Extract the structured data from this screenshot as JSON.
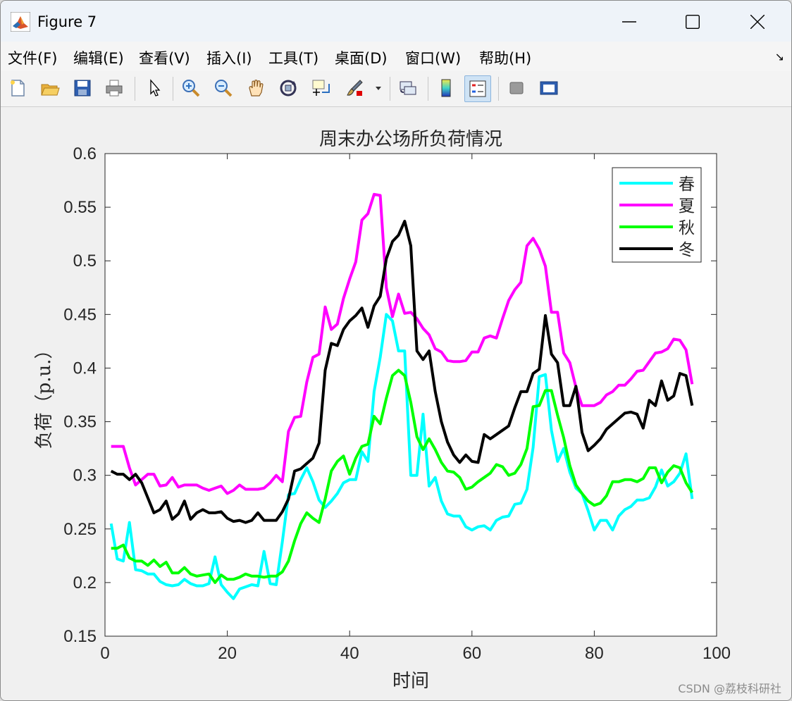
{
  "window": {
    "title": "Figure 7",
    "accent": "#eef3f9"
  },
  "menu": [
    "文件(F)",
    "编辑(E)",
    "查看(V)",
    "插入(I)",
    "工具(T)",
    "桌面(D)",
    "窗口(W)",
    "帮助(H)"
  ],
  "toolbar": {
    "icons": [
      "new-figure-icon",
      "open-file-icon",
      "save-icon",
      "print-icon",
      "pointer-icon",
      "zoom-in-icon",
      "zoom-out-icon",
      "pan-icon",
      "rotate-3d-icon",
      "data-cursor-icon",
      "brush-icon",
      "link-plot-icon",
      "colorbar-icon",
      "legend-icon",
      "hide-plot-tools-icon",
      "show-plot-tools-icon"
    ]
  },
  "watermark": "CSDN @荔枝科研社",
  "chart_data": {
    "type": "line",
    "title": "周末办公场所负荷情况",
    "xlabel": "时间",
    "ylabel": "负荷（p.u.）",
    "xlim": [
      0,
      100
    ],
    "ylim": [
      0.15,
      0.6
    ],
    "xticks": [
      0,
      20,
      40,
      60,
      80,
      100
    ],
    "yticks": [
      0.15,
      0.2,
      0.25,
      0.3,
      0.35,
      0.4,
      0.45,
      0.5,
      0.55,
      0.6
    ],
    "xtick_labels": [
      "0",
      "20",
      "40",
      "60",
      "80",
      "100"
    ],
    "ytick_labels": [
      "0.15",
      "0.2",
      "0.25",
      "0.3",
      "0.35",
      "0.4",
      "0.45",
      "0.5",
      "0.55",
      "0.6"
    ],
    "grid": false,
    "legend_position": "top-right",
    "x": [
      1,
      2,
      3,
      4,
      5,
      6,
      7,
      8,
      9,
      10,
      11,
      12,
      13,
      14,
      15,
      16,
      17,
      18,
      19,
      20,
      21,
      22,
      23,
      24,
      25,
      26,
      27,
      28,
      29,
      30,
      31,
      32,
      33,
      34,
      35,
      36,
      37,
      38,
      39,
      40,
      41,
      42,
      43,
      44,
      45,
      46,
      47,
      48,
      49,
      50,
      51,
      52,
      53,
      54,
      55,
      56,
      57,
      58,
      59,
      60,
      61,
      62,
      63,
      64,
      65,
      66,
      67,
      68,
      69,
      70,
      71,
      72,
      73,
      74,
      75,
      76,
      77,
      78,
      79,
      80,
      81,
      82,
      83,
      84,
      85,
      86,
      87,
      88,
      89,
      90,
      91,
      92,
      93,
      94,
      95,
      96
    ],
    "series": [
      {
        "name": "春",
        "color": "#00ffff",
        "values": [
          0.255,
          0.222,
          0.22,
          0.256,
          0.212,
          0.211,
          0.208,
          0.208,
          0.201,
          0.198,
          0.197,
          0.198,
          0.203,
          0.199,
          0.197,
          0.197,
          0.199,
          0.224,
          0.198,
          0.191,
          0.185,
          0.194,
          0.196,
          0.198,
          0.197,
          0.229,
          0.199,
          0.198,
          0.238,
          0.282,
          0.283,
          0.296,
          0.307,
          0.294,
          0.277,
          0.27,
          0.276,
          0.283,
          0.293,
          0.296,
          0.296,
          0.322,
          0.313,
          0.378,
          0.41,
          0.45,
          0.444,
          0.416,
          0.416,
          0.3,
          0.3,
          0.357,
          0.29,
          0.298,
          0.276,
          0.264,
          0.262,
          0.262,
          0.252,
          0.249,
          0.252,
          0.253,
          0.249,
          0.258,
          0.261,
          0.262,
          0.273,
          0.274,
          0.287,
          0.326,
          0.392,
          0.394,
          0.342,
          0.313,
          0.325,
          0.303,
          0.288,
          0.283,
          0.267,
          0.249,
          0.258,
          0.258,
          0.249,
          0.262,
          0.268,
          0.271,
          0.277,
          0.277,
          0.279,
          0.289,
          0.305,
          0.29,
          0.294,
          0.302,
          0.32,
          0.278
        ]
      },
      {
        "name": "夏",
        "color": "#ff00ff",
        "values": [
          0.327,
          0.327,
          0.327,
          0.307,
          0.291,
          0.296,
          0.301,
          0.301,
          0.29,
          0.291,
          0.298,
          0.289,
          0.291,
          0.291,
          0.291,
          0.288,
          0.286,
          0.288,
          0.29,
          0.283,
          0.286,
          0.291,
          0.287,
          0.287,
          0.287,
          0.288,
          0.293,
          0.3,
          0.294,
          0.341,
          0.354,
          0.355,
          0.387,
          0.41,
          0.413,
          0.457,
          0.436,
          0.441,
          0.465,
          0.483,
          0.499,
          0.538,
          0.544,
          0.562,
          0.561,
          0.475,
          0.448,
          0.469,
          0.451,
          0.452,
          0.446,
          0.437,
          0.431,
          0.418,
          0.415,
          0.407,
          0.406,
          0.406,
          0.407,
          0.415,
          0.415,
          0.428,
          0.43,
          0.428,
          0.446,
          0.463,
          0.473,
          0.48,
          0.514,
          0.521,
          0.511,
          0.495,
          0.452,
          0.452,
          0.414,
          0.405,
          0.382,
          0.365,
          0.365,
          0.365,
          0.368,
          0.375,
          0.378,
          0.384,
          0.384,
          0.39,
          0.397,
          0.398,
          0.406,
          0.414,
          0.415,
          0.418,
          0.427,
          0.426,
          0.417,
          0.385
        ]
      },
      {
        "name": "秋",
        "color": "#00ff00",
        "values": [
          0.232,
          0.232,
          0.235,
          0.223,
          0.22,
          0.22,
          0.216,
          0.221,
          0.215,
          0.219,
          0.209,
          0.209,
          0.214,
          0.208,
          0.206,
          0.207,
          0.208,
          0.2,
          0.207,
          0.203,
          0.203,
          0.205,
          0.208,
          0.206,
          0.206,
          0.205,
          0.206,
          0.206,
          0.21,
          0.22,
          0.239,
          0.255,
          0.265,
          0.26,
          0.256,
          0.278,
          0.304,
          0.313,
          0.318,
          0.301,
          0.316,
          0.327,
          0.329,
          0.355,
          0.348,
          0.372,
          0.393,
          0.398,
          0.393,
          0.368,
          0.336,
          0.324,
          0.334,
          0.324,
          0.312,
          0.304,
          0.303,
          0.298,
          0.287,
          0.289,
          0.294,
          0.298,
          0.302,
          0.31,
          0.308,
          0.3,
          0.302,
          0.31,
          0.325,
          0.364,
          0.365,
          0.379,
          0.379,
          0.356,
          0.335,
          0.309,
          0.291,
          0.283,
          0.276,
          0.272,
          0.274,
          0.281,
          0.294,
          0.294,
          0.296,
          0.296,
          0.294,
          0.297,
          0.307,
          0.307,
          0.293,
          0.303,
          0.309,
          0.307,
          0.293,
          0.284
        ]
      },
      {
        "name": "冬",
        "color": "#000000",
        "values": [
          0.304,
          0.301,
          0.301,
          0.296,
          0.301,
          0.293,
          0.279,
          0.265,
          0.268,
          0.276,
          0.259,
          0.264,
          0.276,
          0.259,
          0.265,
          0.268,
          0.265,
          0.265,
          0.266,
          0.26,
          0.257,
          0.258,
          0.256,
          0.258,
          0.265,
          0.258,
          0.258,
          0.258,
          0.266,
          0.278,
          0.304,
          0.306,
          0.311,
          0.316,
          0.33,
          0.398,
          0.423,
          0.421,
          0.436,
          0.444,
          0.449,
          0.456,
          0.438,
          0.458,
          0.467,
          0.502,
          0.518,
          0.524,
          0.537,
          0.514,
          0.416,
          0.408,
          0.416,
          0.378,
          0.35,
          0.331,
          0.319,
          0.312,
          0.319,
          0.313,
          0.312,
          0.338,
          0.334,
          0.338,
          0.342,
          0.346,
          0.363,
          0.378,
          0.378,
          0.395,
          0.399,
          0.449,
          0.413,
          0.405,
          0.365,
          0.365,
          0.383,
          0.34,
          0.323,
          0.328,
          0.334,
          0.343,
          0.348,
          0.353,
          0.358,
          0.359,
          0.357,
          0.344,
          0.37,
          0.365,
          0.388,
          0.37,
          0.374,
          0.395,
          0.393,
          0.365
        ]
      }
    ]
  }
}
